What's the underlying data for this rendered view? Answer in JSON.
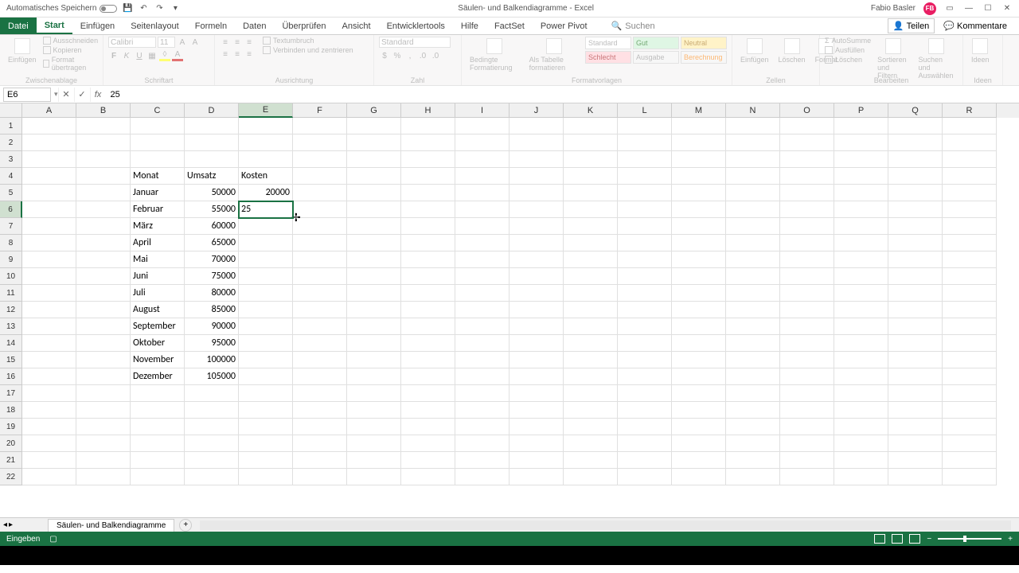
{
  "titlebar": {
    "autosave": "Automatisches Speichern",
    "doc_title": "Säulen- und Balkendiagramme - Excel",
    "user": "Fabio Basler",
    "avatar_initials": "FB"
  },
  "tabs": {
    "file": "Datei",
    "start": "Start",
    "insert": "Einfügen",
    "layout": "Seitenlayout",
    "formulas": "Formeln",
    "data": "Daten",
    "review": "Überprüfen",
    "view": "Ansicht",
    "dev": "Entwicklertools",
    "help": "Hilfe",
    "factset": "FactSet",
    "powerpivot": "Power Pivot",
    "search": "Suchen",
    "share": "Teilen",
    "comments": "Kommentare"
  },
  "ribbon": {
    "paste": "Einfügen",
    "cut": "Ausschneiden",
    "copy": "Kopieren",
    "format_painter": "Format übertragen",
    "clipboard": "Zwischenablage",
    "font_name": "Calibri",
    "font_size": "11",
    "font_group": "Schriftart",
    "wrap": "Textumbruch",
    "merge": "Verbinden und zentrieren",
    "align_group": "Ausrichtung",
    "number_format": "Standard",
    "number_group": "Zahl",
    "cond_format": "Bedingte Formatierung",
    "as_table": "Als Tabelle formatieren",
    "styles_group": "Formatvorlagen",
    "style_standard": "Standard",
    "style_gut": "Gut",
    "style_neutral": "Neutral",
    "style_schlecht": "Schlecht",
    "style_ausgabe": "Ausgabe",
    "style_berechnung": "Berechnung",
    "insert_cells": "Einfügen",
    "delete_cells": "Löschen",
    "format_cells": "Format",
    "cells_group": "Zellen",
    "autosum": "AutoSumme",
    "fill": "Ausfüllen",
    "clear": "Löschen",
    "sort": "Sortieren und Filtern",
    "find": "Suchen und Auswählen",
    "edit_group": "Bearbeiten",
    "ideas": "Ideen",
    "ideas_group": "Ideen"
  },
  "formula_bar": {
    "name_box": "E6",
    "formula": "25"
  },
  "columns": [
    "A",
    "B",
    "C",
    "D",
    "E",
    "F",
    "G",
    "H",
    "I",
    "J",
    "K",
    "L",
    "M",
    "N",
    "O",
    "P",
    "Q",
    "R"
  ],
  "active_col": "E",
  "active_row": 6,
  "grid": {
    "headers": {
      "monat": "Monat",
      "umsatz": "Umsatz",
      "kosten": "Kosten"
    },
    "rows": [
      {
        "monat": "Januar",
        "umsatz": "50000",
        "kosten": "20000"
      },
      {
        "monat": "Februar",
        "umsatz": "55000",
        "kosten": "25"
      },
      {
        "monat": "März",
        "umsatz": "60000",
        "kosten": ""
      },
      {
        "monat": "April",
        "umsatz": "65000",
        "kosten": ""
      },
      {
        "monat": "Mai",
        "umsatz": "70000",
        "kosten": ""
      },
      {
        "monat": "Juni",
        "umsatz": "75000",
        "kosten": ""
      },
      {
        "monat": "Juli",
        "umsatz": "80000",
        "kosten": ""
      },
      {
        "monat": "August",
        "umsatz": "85000",
        "kosten": ""
      },
      {
        "monat": "September",
        "umsatz": "90000",
        "kosten": ""
      },
      {
        "monat": "Oktober",
        "umsatz": "95000",
        "kosten": ""
      },
      {
        "monat": "November",
        "umsatz": "100000",
        "kosten": ""
      },
      {
        "monat": "Dezember",
        "umsatz": "105000",
        "kosten": ""
      }
    ]
  },
  "sheet": {
    "name": "Säulen- und Balkendiagramme"
  },
  "status": {
    "mode": "Eingeben"
  },
  "chart_data": {
    "type": "table",
    "title": "Monat / Umsatz / Kosten",
    "columns": [
      "Monat",
      "Umsatz",
      "Kosten"
    ],
    "rows": [
      [
        "Januar",
        50000,
        20000
      ],
      [
        "Februar",
        55000,
        null
      ],
      [
        "März",
        60000,
        null
      ],
      [
        "April",
        65000,
        null
      ],
      [
        "Mai",
        70000,
        null
      ],
      [
        "Juni",
        75000,
        null
      ],
      [
        "Juli",
        80000,
        null
      ],
      [
        "August",
        85000,
        null
      ],
      [
        "September",
        90000,
        null
      ],
      [
        "Oktober",
        95000,
        null
      ],
      [
        "November",
        100000,
        null
      ],
      [
        "Dezember",
        105000,
        null
      ]
    ]
  }
}
